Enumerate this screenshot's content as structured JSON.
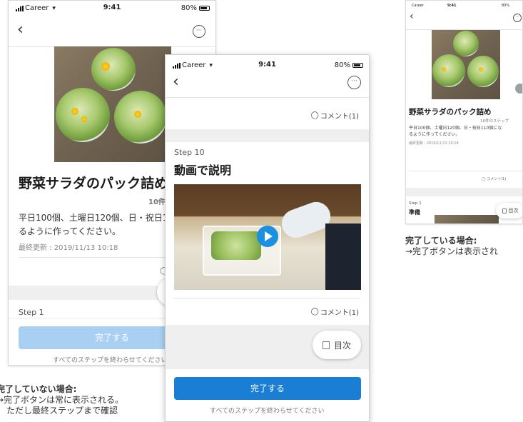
{
  "status": {
    "carrier": "Career",
    "time": "9:41",
    "battery": "80%"
  },
  "colors": {
    "primary": "#1a7fd4",
    "primary_disabled": "#a9d0f2",
    "gray_bg": "#efefef"
  },
  "left_screen": {
    "title": "野菜サラダのパック詰め",
    "steps_count": "10件",
    "description_line1": "平日100個、土曜日120個、日・祝日1",
    "description_line2": "るように作ってください。",
    "updated": "最終更新 : 2019/11/13 10:18",
    "step_label": "Step 1",
    "complete_button": "完了する",
    "hint": "すべてのステップを終わらせてください"
  },
  "middle_screen": {
    "comment_top": "コメント(1)",
    "step_label": "Step 10",
    "step_title": "動画で説明",
    "comment_bottom": "コメント(1)",
    "toc": "目次",
    "complete_button": "完了する",
    "hint": "すべてのステップを終わらせてください"
  },
  "right_screen": {
    "title": "野菜サラダのパック詰め",
    "steps_count": "10件のステップ",
    "description_line1": "平日100個、土曜日120個、日・祝日110個にな",
    "description_line2": "るように作ってください。",
    "updated": "最終更新 : 2019/11/13 10:18",
    "comment": "コメント(1)",
    "step_label": "Step 1",
    "step_title": "準備",
    "toc": "目次"
  },
  "caption_left": {
    "title": "完了していない場合:",
    "line1": "→完了ボタンは常に表示される。",
    "line2": "ただし最終ステップまで確認"
  },
  "caption_right": {
    "title": "完了している場合:",
    "line1": "→完了ボタンは表示され"
  },
  "icons": {
    "back": "chevron-left-icon",
    "more": "more-icon",
    "comment": "comment-bubble-icon",
    "toc": "toc-icon",
    "play": "play-icon",
    "signal": "signal-icon",
    "wifi": "wifi-icon",
    "battery": "battery-icon"
  }
}
